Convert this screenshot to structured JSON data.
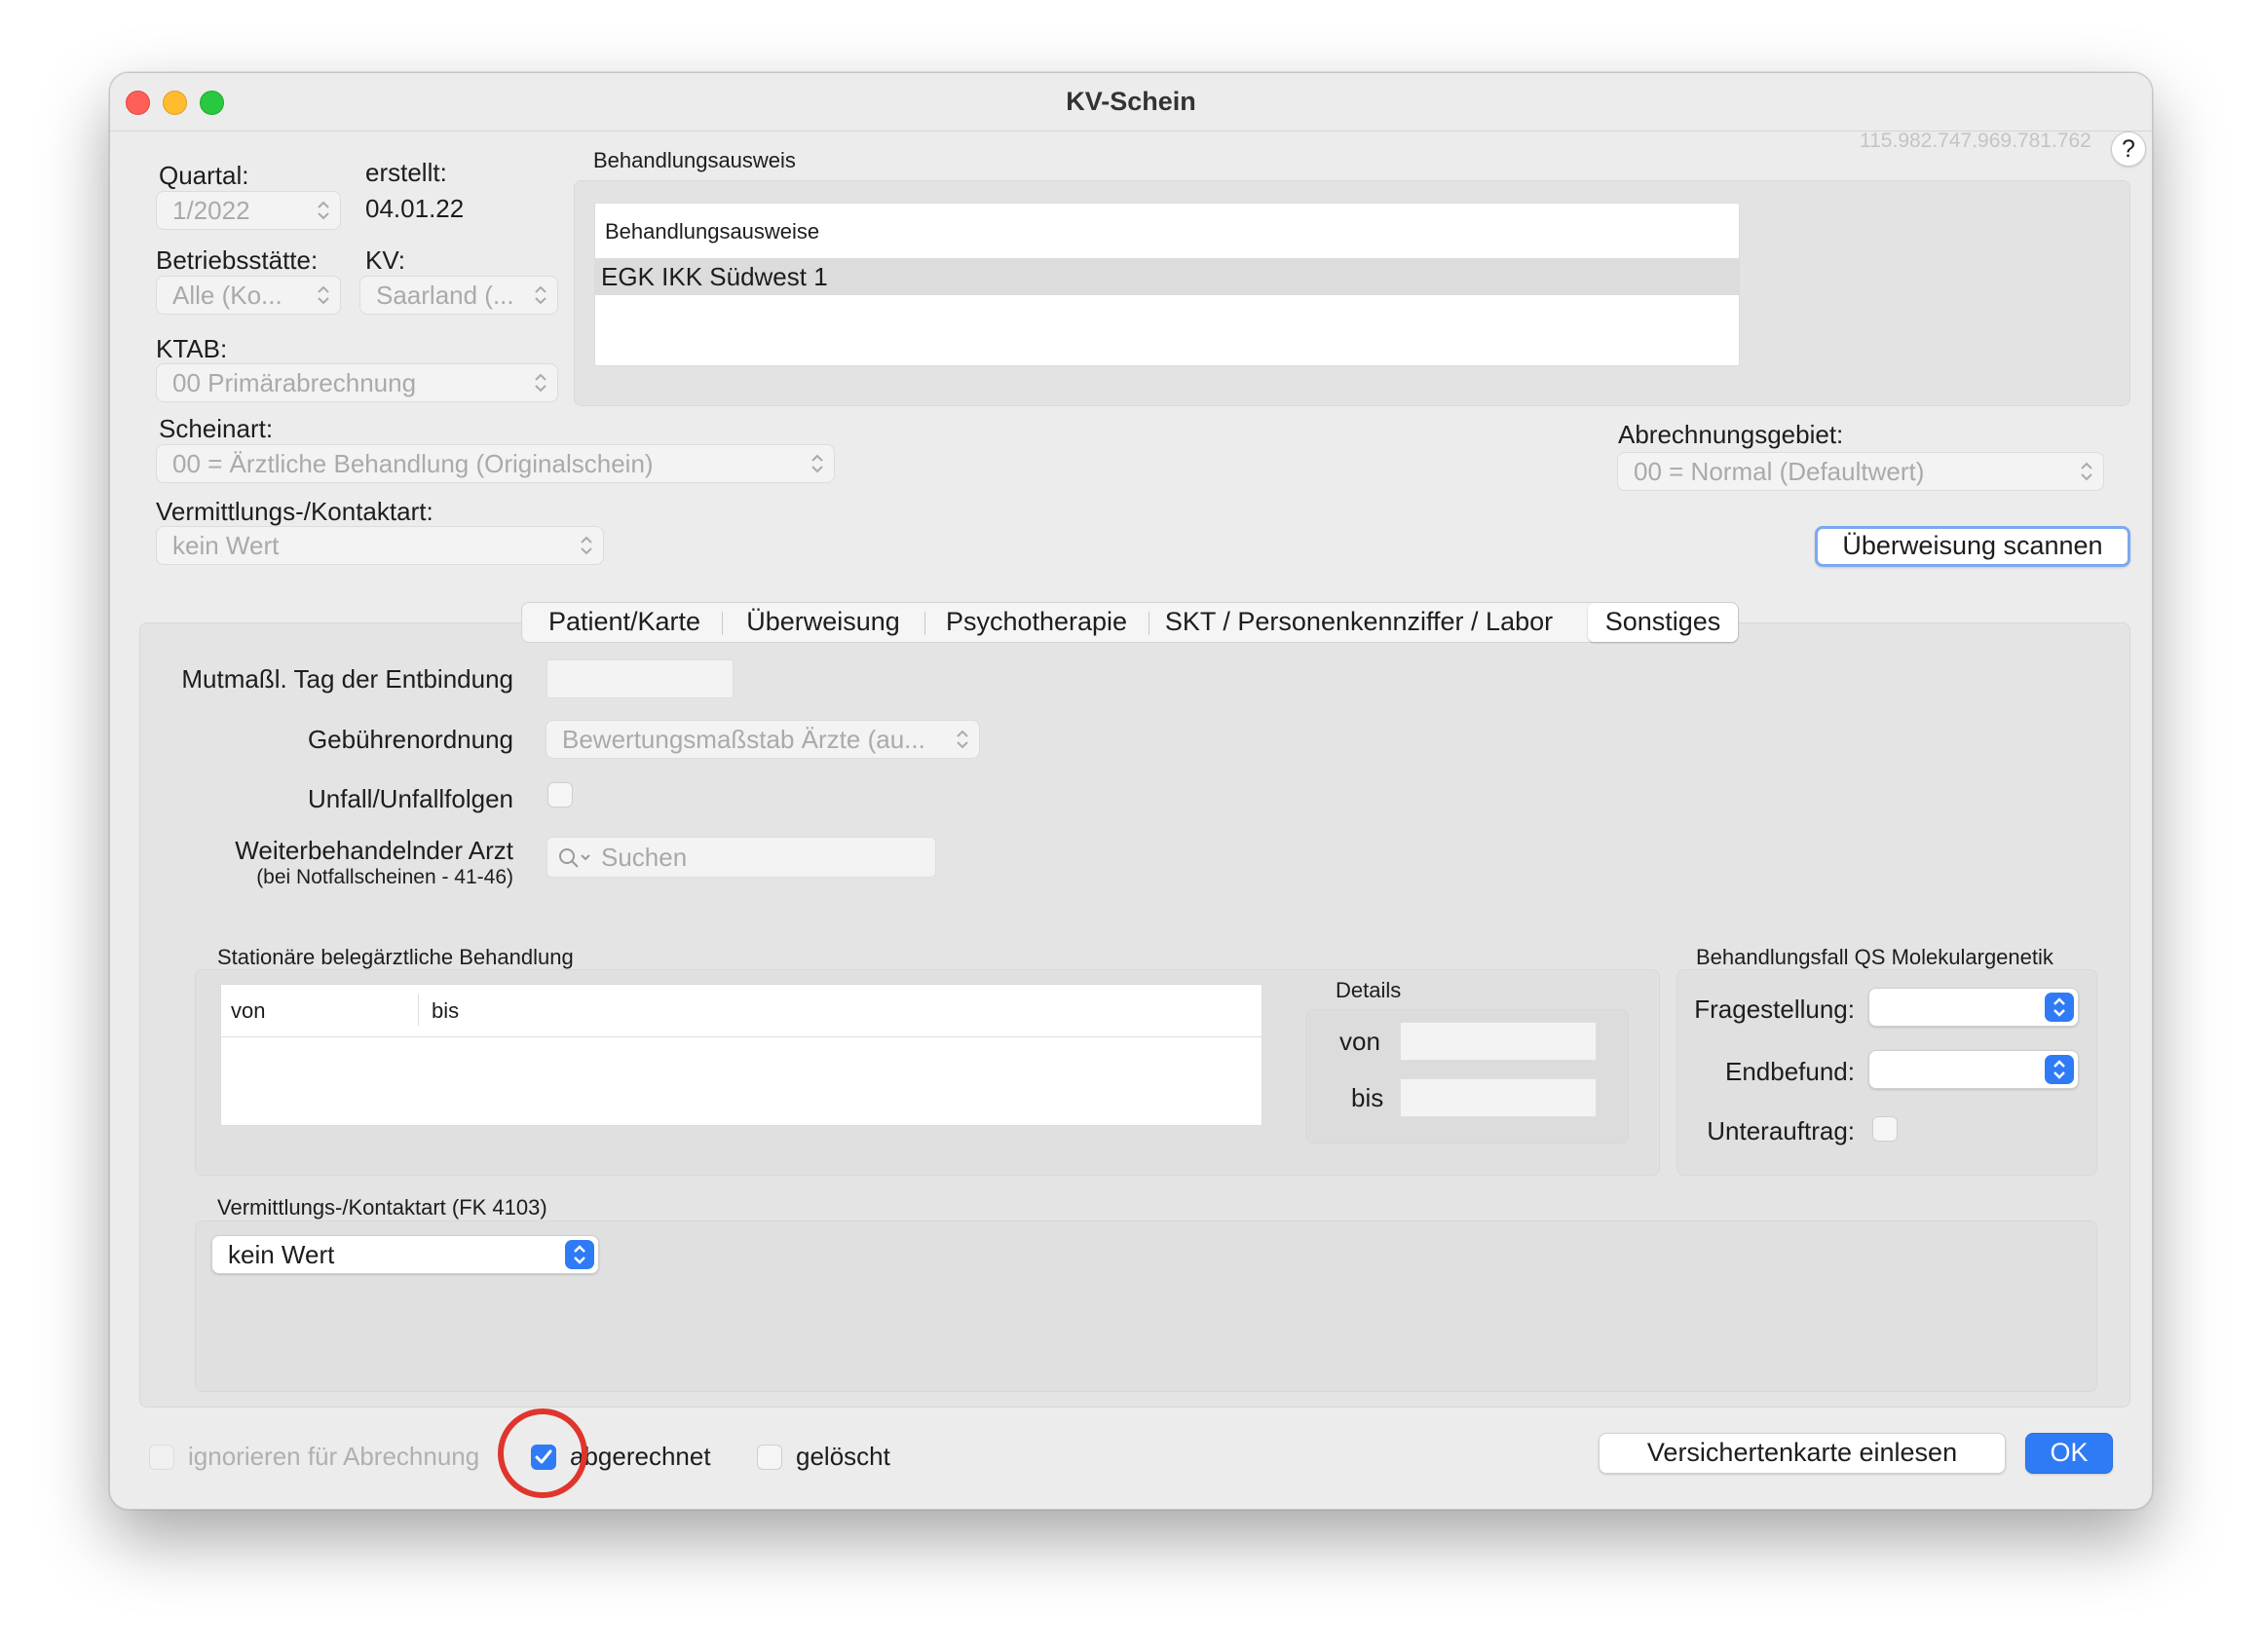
{
  "window": {
    "title": "KV-Schein",
    "id_code": "115.982.747.969.781.762",
    "help": "?"
  },
  "header": {
    "quartal_label": "Quartal:",
    "quartal_value": "1/2022",
    "erstellt_label": "erstellt:",
    "erstellt_value": "04.01.22",
    "betriebsstaette_label": "Betriebsstätte:",
    "betriebsstaette_value": "Alle (Ko...",
    "kv_label": "KV:",
    "kv_value": "Saarland (...",
    "ktab_label": "KTAB:",
    "ktab_value": "00 Primärabrechnung",
    "scheinart_label": "Scheinart:",
    "scheinart_value": "00 = Ärztliche Behandlung (Originalschein)",
    "vermittlung_label": "Vermittlungs-/Kontaktart:",
    "vermittlung_value": "kein Wert",
    "abrechnungsgebiet_label": "Abrechnungsgebiet:",
    "abrechnungsgebiet_value": "00 = Normal (Defaultwert)",
    "scan_button": "Überweisung scannen"
  },
  "behandlungsausweis": {
    "group_title": "Behandlungsausweis",
    "column_header": "Behandlungsausweise",
    "rows": [
      "EGK IKK Südwest 1"
    ]
  },
  "tabs": [
    {
      "label": "Patient/Karte",
      "selected": false
    },
    {
      "label": "Überweisung",
      "selected": false
    },
    {
      "label": "Psychotherapie",
      "selected": false
    },
    {
      "label": "SKT / Personenkennziffer / Labor",
      "selected": false
    },
    {
      "label": "Sonstiges",
      "selected": true
    }
  ],
  "sonstiges": {
    "entbindung_label": "Mutmaßl. Tag der Entbindung",
    "gebuehren_label": "Gebührenordnung",
    "gebuehren_value": "Bewertungsmaßstab Ärzte (au...",
    "unfall_label": "Unfall/Unfallfolgen",
    "arzt_label": "Weiterbehandelnder Arzt",
    "arzt_sublabel": "(bei Notfallscheinen - 41-46)",
    "search_placeholder": "Suchen",
    "stationaer_title": "Stationäre belegärztliche Behandlung",
    "stationaer_columns": [
      "von",
      "bis"
    ],
    "details_title": "Details",
    "details_von": "von",
    "details_bis": "bis",
    "qs_title": "Behandlungsfall QS Molekulargenetik",
    "fragestellung_label": "Fragestellung:",
    "endbefund_label": "Endbefund:",
    "unterauftrag_label": "Unterauftrag:",
    "fk4103_title": "Vermittlungs-/Kontaktart (FK 4103)",
    "fk4103_value": "kein Wert"
  },
  "footer": {
    "ignorieren_label": "ignorieren für Abrechnung",
    "abgerechnet_label": "abgerechnet",
    "abgerechnet_checked": true,
    "geloescht_label": "gelöscht",
    "karte_button": "Versichertenkarte einlesen",
    "ok_button": "OK"
  },
  "colors": {
    "accent": "#2f7bf5",
    "highlight_ring": "#e0352b"
  }
}
